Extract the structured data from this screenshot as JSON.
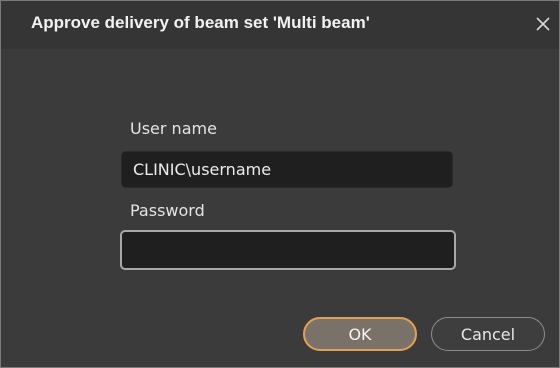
{
  "dialog": {
    "title": "Approve delivery of beam set 'Multi beam'",
    "close_icon": "close-icon"
  },
  "form": {
    "username_label": "User name",
    "username_value": "CLINIC\\username",
    "password_label": "Password",
    "password_value": ""
  },
  "buttons": {
    "ok_label": "OK",
    "cancel_label": "Cancel"
  },
  "colors": {
    "dialog_background": "#3b3b3b",
    "field_background": "#1f1f1f",
    "ok_focus_border": "#e2a059"
  }
}
